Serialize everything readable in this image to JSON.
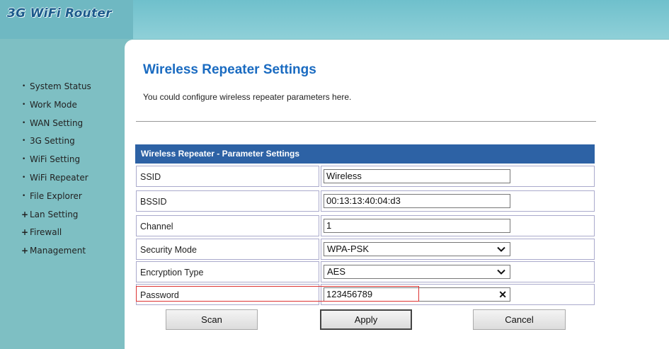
{
  "header": {
    "logo_text": "3G WiFi Router"
  },
  "nav": {
    "items": [
      {
        "label": "System Status",
        "marker": "•"
      },
      {
        "label": "Work Mode",
        "marker": "•"
      },
      {
        "label": "WAN Setting",
        "marker": "•"
      },
      {
        "label": "3G Setting",
        "marker": "•"
      },
      {
        "label": "WiFi Setting",
        "marker": "•"
      },
      {
        "label": "WiFi Repeater",
        "marker": "•"
      },
      {
        "label": "File Explorer",
        "marker": "•"
      },
      {
        "label": "Lan Setting",
        "marker": "+"
      },
      {
        "label": "Firewall",
        "marker": "+"
      },
      {
        "label": "Management",
        "marker": "+"
      }
    ]
  },
  "page": {
    "title": "Wireless Repeater Settings",
    "description": "You could configure wireless repeater parameters here."
  },
  "table": {
    "header": "Wireless Repeater - Parameter Settings",
    "ssid": {
      "label": "SSID",
      "value": "Wireless"
    },
    "bssid": {
      "label": "BSSID",
      "value": "00:13:13:40:04:d3"
    },
    "channel": {
      "label": "Channel",
      "value": "1"
    },
    "security_mode": {
      "label": "Security Mode",
      "value": "WPA-PSK"
    },
    "encryption_type": {
      "label": "Encryption Type",
      "value": "AES"
    },
    "password": {
      "label": "Password",
      "value": "123456789"
    }
  },
  "buttons": {
    "scan": "Scan",
    "apply": "Apply",
    "cancel": "Cancel"
  },
  "colors": {
    "accent_title": "#1a6bc1",
    "table_header": "#2d62a5",
    "sidebar": "#7ebfc3",
    "highlight": "#dd3333"
  }
}
